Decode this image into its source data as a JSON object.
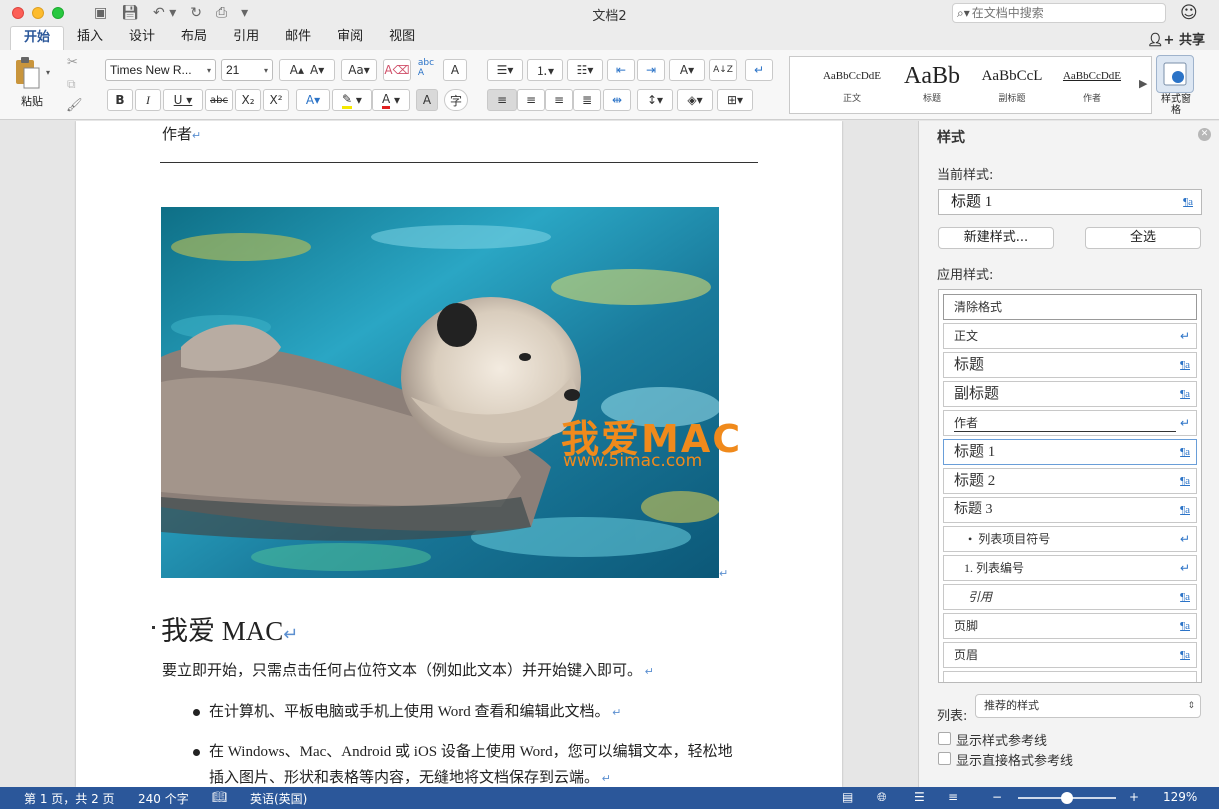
{
  "window": {
    "title": "文档2"
  },
  "search": {
    "placeholder": "在文档中搜索"
  },
  "tabs": [
    "开始",
    "插入",
    "设计",
    "布局",
    "引用",
    "邮件",
    "审阅",
    "视图"
  ],
  "share_label": "共享",
  "ribbon": {
    "paste_label": "粘贴",
    "font_name": "Times New R...",
    "font_size": "21",
    "bold": "B",
    "italic": "I",
    "underline": "U",
    "strike": "abc",
    "subscript": "X₂",
    "superscript": "X²",
    "char_shading": "A",
    "phonetic": "字",
    "styles_pane_label": "样式窗格",
    "style_gallery": [
      {
        "preview": "AaBbCcDdE",
        "name": "正文"
      },
      {
        "preview": "AaBb",
        "name": "标题"
      },
      {
        "preview": "AaBbCcL",
        "name": "副标题"
      },
      {
        "preview": "AaBbCcDdE",
        "name": "作者"
      }
    ]
  },
  "document": {
    "author_line": "作者",
    "watermark_cn": "我爱MAC",
    "watermark_url": "www.5imac.com",
    "heading": "我爱 MAC",
    "intro": "要立即开始，只需点击任何占位符文本（例如此文本）并开始键入即可。",
    "bullets": [
      [
        "在计算机、平板电脑或手机上使用 Word 查看和编辑此文档。"
      ],
      [
        "在 Windows、Mac、Android 或 iOS 设备上使用 Word，您可以编辑文本，轻松地",
        "插入图片、形状和表格等内容，无缝地将文档保存到云端。"
      ]
    ]
  },
  "styles_pane": {
    "title": "样式",
    "current_label": "当前样式:",
    "current_value": "标题 1",
    "new_style_button": "新建样式...",
    "select_all_button": "全选",
    "apply_label": "应用样式:",
    "styles": [
      {
        "name": "清除格式",
        "mark": ""
      },
      {
        "name": "正文",
        "mark": "↵"
      },
      {
        "name": "标题",
        "mark": "¶a"
      },
      {
        "name": "副标题",
        "mark": "¶a"
      },
      {
        "name": "作者",
        "mark": "↵"
      },
      {
        "name": "标题 1",
        "mark": "¶a"
      },
      {
        "name": "标题 2",
        "mark": "¶a"
      },
      {
        "name": "标题 3",
        "mark": "¶a"
      },
      {
        "name": "列表项目符号",
        "mark": "↵"
      },
      {
        "name": "1. 列表编号",
        "mark": "↵"
      },
      {
        "name": "引用",
        "mark": "¶a"
      },
      {
        "name": "页脚",
        "mark": "¶a"
      },
      {
        "name": "页眉",
        "mark": "¶a"
      }
    ],
    "list_label": "列表:",
    "list_value": "推荐的样式",
    "show_guides": "显示样式参考线",
    "show_direct_guides": "显示直接格式参考线"
  },
  "status_bar": {
    "page": "第 1 页，共 2 页",
    "words": "240 个字",
    "language": "英语(英国)",
    "zoom": "129%",
    "zoom_level_fraction": 0.5
  },
  "colors": {
    "accent": "#2b579a",
    "watermark_orange": "#f08a1c",
    "watermark_blue": "#2f8fe0"
  }
}
